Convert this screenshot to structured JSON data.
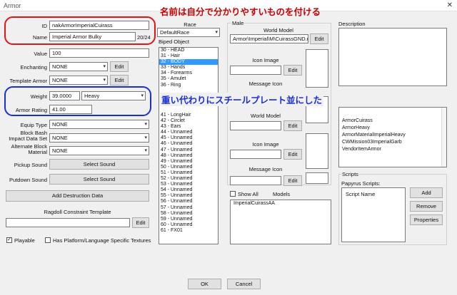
{
  "window": {
    "title": "Armor",
    "close": "✕"
  },
  "annotations": {
    "name_note": "名前は自分で分かりやすいものを付ける",
    "weight_note": "重い代わりにスチールプレート並にした"
  },
  "fields": {
    "id_label": "ID",
    "id_value": "nakArmorImperialCuirass",
    "name_label": "Name",
    "name_value": "Imperial Armor Bulky",
    "name_count": "20/24",
    "value_label": "Value",
    "value_value": "100",
    "enchanting_label": "Enchanting",
    "enchanting_value": "NONE",
    "template_label": "Template Armor",
    "template_value": "NONE",
    "weight_label": "Weight",
    "weight_value": "39.0000",
    "weight_class": "Heavy",
    "rating_label": "Armor Rating",
    "rating_value": "41.00",
    "equip_label": "Equip Type",
    "equip_value": "NONE",
    "bash_label": "Block Bash Impact Data Set",
    "bash_value": "NONE",
    "alt_label": "Alternate Block Material",
    "alt_value": "NONE",
    "pickup_label": "Pickup Sound",
    "pickup_btn": "Select Sound",
    "putdown_label": "Putdown Sound",
    "putdown_btn": "Select Sound",
    "destruction_btn": "Add Destruction Data",
    "ragdoll_label": "Ragdoll Constraint Template",
    "ragdoll_edit": "Edit",
    "playable": "Playable",
    "platform": "Has Platform/Language Specific Textures"
  },
  "race": {
    "label": "Race",
    "value": "DefaultRace",
    "biped_label": "Biped Object",
    "biped_top": [
      "30 - HEAD",
      "31 - Hair",
      "32 - BODY",
      "33 - Hands",
      "34 - Forearms",
      "35 - Amulet",
      "36 - Ring"
    ],
    "biped_bottom": [
      "41 - LongHair",
      "42 - Circlet",
      "43 - Ears",
      "44 - Unnamed",
      "45 - Unnamed",
      "46 - Unnamed",
      "47 - Unnamed",
      "48 - Unnamed",
      "49 - Unnamed",
      "50 - Unnamed",
      "51 - Unnamed",
      "52 - Unnamed",
      "53 - Unnamed",
      "54 - Unnamed",
      "55 - Unnamed",
      "56 - Unnamed",
      "57 - Unnamed",
      "58 - Unnamed",
      "59 - Unnamed",
      "60 - Unnamed",
      "61 - FX01"
    ]
  },
  "male": {
    "label": "Male",
    "world_model": "World Model",
    "world_model_path": "Armor\\Imperial\\M\\CuirassGND.nif",
    "icon_image": "Icon Image",
    "message_icon": "Message Icon",
    "edit": "Edit"
  },
  "female": {
    "world_model": "World Model",
    "icon_image": "Icon Image",
    "message_icon": "Message Icon",
    "edit": "Edit"
  },
  "models": {
    "show_all": "Show All",
    "label": "Models",
    "items": [
      "ImperialCuirassAA"
    ]
  },
  "description": {
    "label": "Description"
  },
  "keywords": [
    "ArmorCuirass",
    "ArmorHeavy",
    "ArmorMaterialImperialHeavy",
    "CWMission03ImperialGarb",
    "VendorItemArmor"
  ],
  "scripts": {
    "label": "Scripts",
    "papyrus": "Papyrus Scripts:",
    "column": "Script Name",
    "add": "Add",
    "remove": "Remove",
    "properties": "Properties"
  },
  "footer": {
    "ok": "OK",
    "cancel": "Cancel"
  },
  "colors": {
    "red_note": "#cc0000",
    "blue_note": "#1a2fd4",
    "selection": "#3399ff"
  }
}
